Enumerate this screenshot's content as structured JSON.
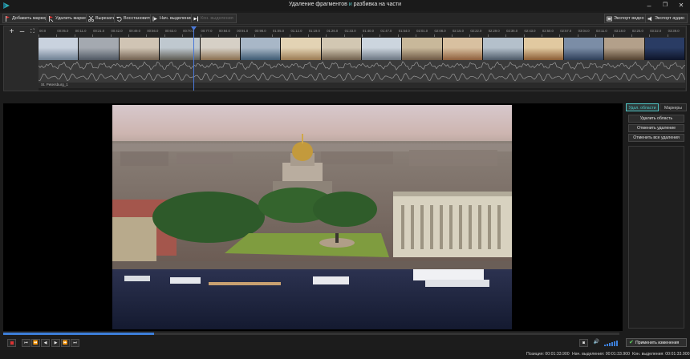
{
  "window": {
    "title_prefix": "Удаление фрагментов",
    "title_highlight": "и",
    "title_suffix": "разбивка на части",
    "minimize": "–",
    "maximize": "❐",
    "close": "✕"
  },
  "toolbar": {
    "add_marker": "Добавить маркер",
    "remove_marker": "Удалить маркер",
    "cut": "Вырезать",
    "restore": "Восстановить",
    "sel_start": "Нач. выделения",
    "sel_end": "Кон. выделения",
    "export_video": "Экспорт видео",
    "export_audio": "Экспорт аудио"
  },
  "timeline": {
    "ticks": [
      "00:0",
      "00:05.0",
      "00:11.0",
      "00:21.0",
      "00:42.0",
      "00:49.0",
      "00:56.0",
      "00:63.0",
      "00:70.0",
      "00:77.0",
      "00:84.0",
      "00:91.0",
      "00:98.0",
      "01:05.0",
      "01:12.0",
      "01:19.0",
      "01:26.0",
      "01:33.0",
      "01:40.0",
      "01:47.0",
      "01:54.0",
      "02:01.0",
      "02:08.0",
      "02:15.0",
      "02:22.0",
      "02:29.0",
      "02:36.0",
      "02:43.0",
      "02:50.0",
      "02:57.0",
      "03:04.0",
      "03:11.0",
      "03:18.0",
      "03:25.0",
      "03:32.0",
      "03:39.0"
    ],
    "track_name": "St. Petersburg_1",
    "playhead_fraction": 0.24
  },
  "right_panel": {
    "tab_delete": "Удал. области",
    "tab_markers": "Маркеры",
    "delete_area": "Удалить область",
    "undo_delete": "Отменить удаление",
    "undo_all": "Отменить все удаления"
  },
  "transport": {
    "progress_fraction": 0.245,
    "apply": "Применить изменения"
  },
  "status": {
    "position": "Позиция: 00:01:33.900",
    "sel_start": "Нач. выделения: 00:01:33.900",
    "sel_end": "Кон. выделения: 00:01:33.900"
  },
  "colors": {
    "accent": "#4fc3c3",
    "playhead": "#4a78d8",
    "record": "#dd3333",
    "apply_check": "#5fd35f"
  }
}
